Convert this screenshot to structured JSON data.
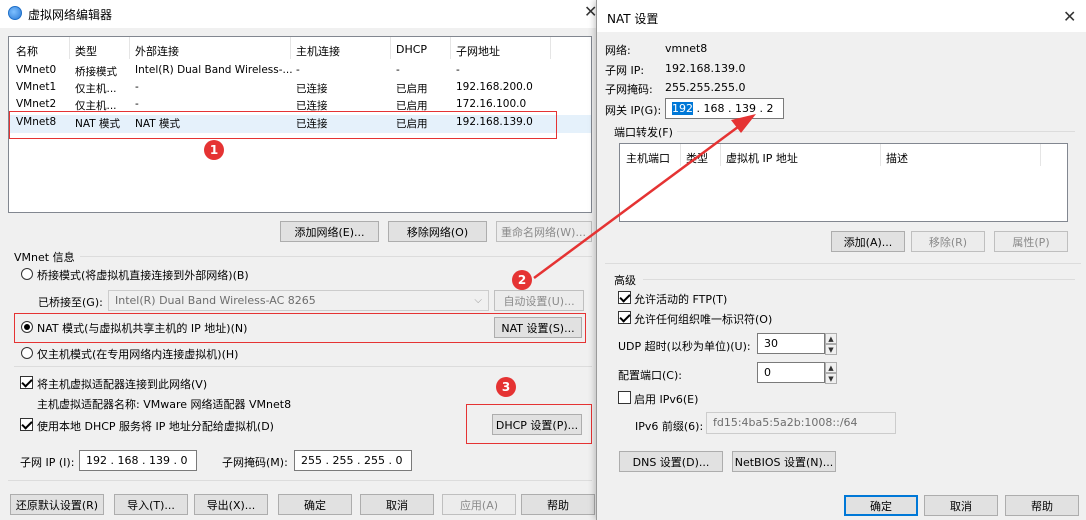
{
  "main": {
    "title": "虚拟网络编辑器",
    "table": {
      "headers": [
        "名称",
        "类型",
        "外部连接",
        "主机连接",
        "DHCP",
        "子网地址"
      ],
      "rows": [
        [
          "VMnet0",
          "桥接模式",
          "Intel(R) Dual Band Wireless-...",
          "-",
          "-",
          "-"
        ],
        [
          "VMnet1",
          "仅主机...",
          "-",
          "已连接",
          "已启用",
          "192.168.200.0"
        ],
        [
          "VMnet2",
          "仅主机...",
          "-",
          "已连接",
          "已启用",
          "172.16.100.0"
        ],
        [
          "VMnet8",
          "NAT 模式",
          "NAT 模式",
          "已连接",
          "已启用",
          "192.168.139.0"
        ]
      ]
    },
    "buttons": {
      "add_network": "添加网络(E)...",
      "remove_network": "移除网络(O)",
      "rename_network": "重命名网络(W)..."
    },
    "vmnet_info": {
      "group_label": "VMnet 信息",
      "bridge_mode": "桥接模式(将虚拟机直接连接到外部网络)(B)",
      "bridged_to_label": "已桥接至(G):",
      "bridged_to_value": "Intel(R) Dual Band Wireless-AC 8265",
      "auto_settings": "自动设置(U)...",
      "nat_mode": "NAT 模式(与虚拟机共享主机的 IP 地址)(N)",
      "nat_settings": "NAT 设置(S)...",
      "host_only_mode": "仅主机模式(在专用网络内连接虚拟机)(H)",
      "connect_adapter": "将主机虚拟适配器连接到此网络(V)",
      "adapter_name": "主机虚拟适配器名称: VMware 网络适配器 VMnet8",
      "use_dhcp": "使用本地 DHCP 服务将 IP 地址分配给虚拟机(D)",
      "dhcp_settings": "DHCP 设置(P)...",
      "subnet_ip_label": "子网 IP (I):",
      "subnet_ip": "192 . 168 . 139 .  0",
      "subnet_mask_label": "子网掩码(M):",
      "subnet_mask": "255 . 255 . 255 .  0"
    },
    "bottom_buttons": {
      "restore": "还原默认设置(R)",
      "import": "导入(T)...",
      "export": "导出(X)...",
      "ok": "确定",
      "cancel": "取消",
      "apply": "应用(A)",
      "help": "帮助"
    },
    "annotations": [
      "1",
      "2",
      "3"
    ]
  },
  "nat": {
    "title": "NAT 设置",
    "network_label": "网络:",
    "network_value": "vmnet8",
    "subnet_ip_label": "子网 IP:",
    "subnet_ip_value": "192.168.139.0",
    "subnet_mask_label": "子网掩码:",
    "subnet_mask_value": "255.255.255.0",
    "gateway_label": "网关 IP(G):",
    "gateway_first": "192",
    "gateway_rest": " . 168 . 139 .  2",
    "port_forward_label": "端口转发(F)",
    "pf_headers": [
      "主机端口",
      "类型",
      "虚拟机 IP 地址",
      "描述"
    ],
    "pf_buttons": {
      "add": "添加(A)...",
      "remove": "移除(R)",
      "properties": "属性(P)"
    },
    "advanced_label": "高级",
    "allow_ftp": "允许活动的 FTP(T)",
    "allow_oui": "允许任何组织唯一标识符(O)",
    "udp_timeout_label": "UDP 超时(以秒为单位)(U):",
    "udp_timeout_value": "30",
    "config_port_label": "配置端口(C):",
    "config_port_value": "0",
    "enable_ipv6": "启用 IPv6(E)",
    "ipv6_prefix_label": "IPv6 前缀(6):",
    "ipv6_prefix_value": "fd15:4ba5:5a2b:1008::/64",
    "dns_settings": "DNS 设置(D)...",
    "netbios_settings": "NetBIOS 设置(N)...",
    "ok": "确定",
    "cancel": "取消",
    "help": "帮助"
  },
  "colors": {
    "annotation": "#e53333",
    "accent": "#0078d7"
  }
}
